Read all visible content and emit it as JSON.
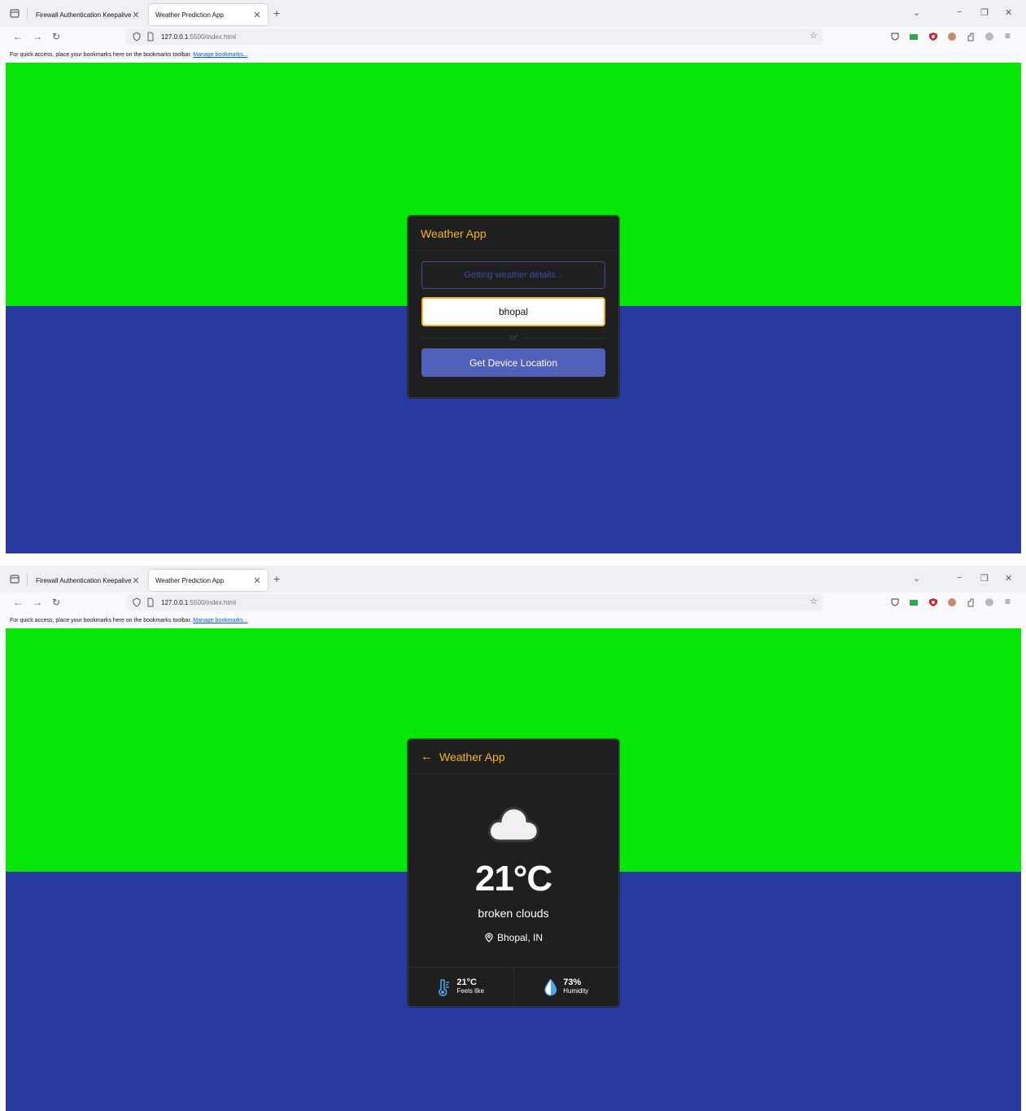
{
  "browser": {
    "tabs": [
      {
        "title": "Firewall Authentication Keepalive W",
        "close": "✕"
      },
      {
        "title": "Weather Prediction App",
        "close": "✕"
      }
    ],
    "new_tab": "+",
    "url_host": "127.0.0.1",
    "url_rest": ":5500/index.html",
    "bookmarks_text": "For quick access, place your bookmarks here on the bookmarks toolbar.",
    "bookmarks_link": "Manage bookmarks..."
  },
  "colors": {
    "bg_top": "#07e707",
    "bg_bottom": "#283aa0",
    "card": "#1f1f1f",
    "accent": "#f2b51b",
    "button": "#5161b9"
  },
  "search_screen": {
    "title": "Weather App",
    "status_text": "Getting weather details...",
    "city_value": "bhopal",
    "divider_text": "or",
    "device_button": "Get Device Location"
  },
  "result_screen": {
    "title": "Weather App",
    "back_icon": "arrow-left-icon",
    "weather_icon": "cloud-icon",
    "temperature": "21°C",
    "description": "broken clouds",
    "location": "Bhopal, IN",
    "feels_like_value": "21°C",
    "feels_like_label": "Feels like",
    "humidity_value": "73%",
    "humidity_label": "Humidity"
  }
}
